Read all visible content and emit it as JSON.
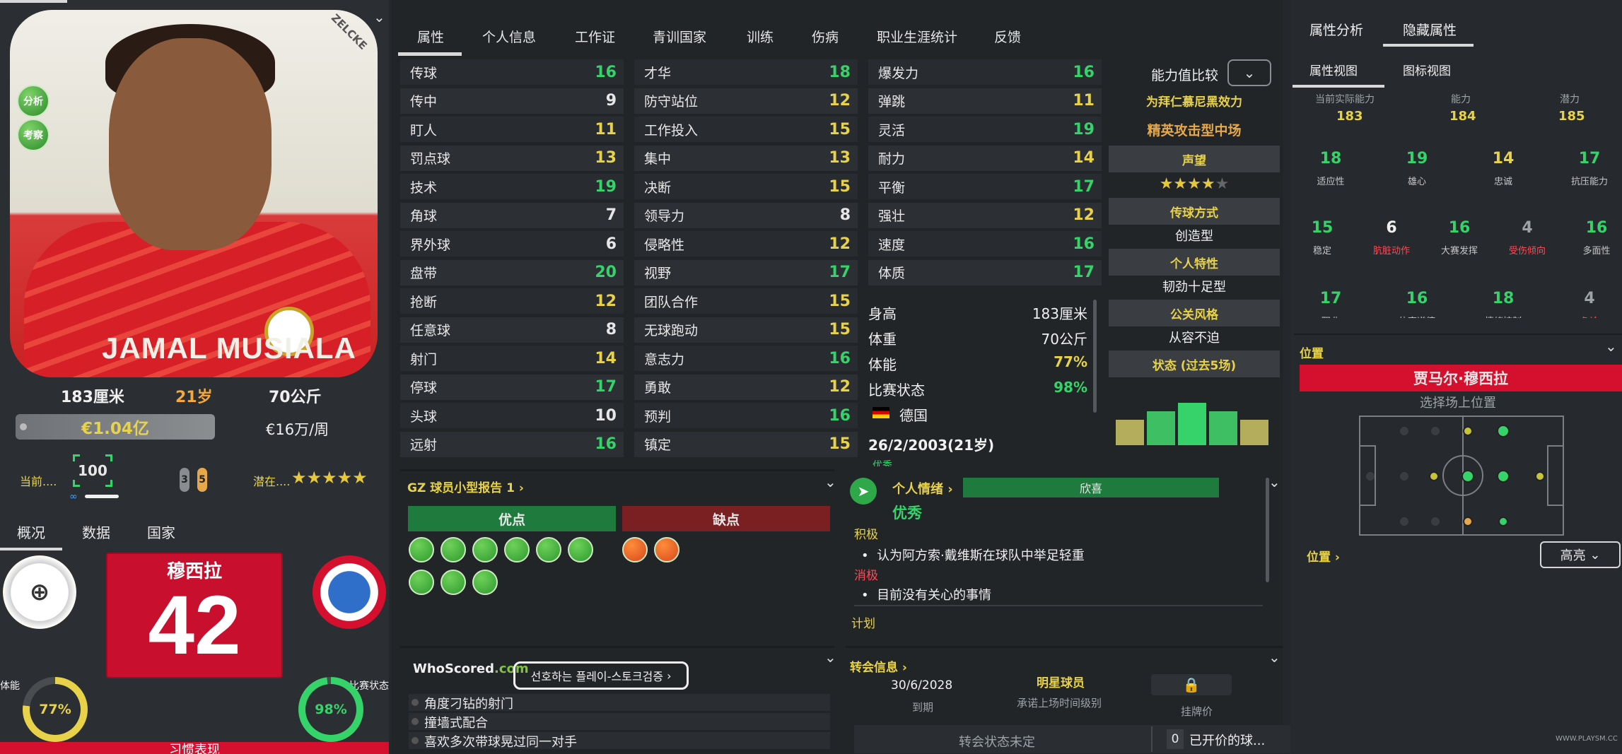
{
  "left": {
    "photo": {
      "brand": "ZELCKE",
      "shirt_name": "JAMAL MUSIALA",
      "btn_analyze": "分析",
      "btn_scout": "考察"
    },
    "height": "183厘米",
    "age": "21岁",
    "weight": "70公斤",
    "value": "€1.04亿",
    "wage": "€16万/周",
    "current_label": "当前....",
    "current_value": "100",
    "pill1": "3",
    "pill2": "5",
    "potential_label": "潜在....",
    "potential_stars": "★★★★★",
    "tabs": {
      "overview": "概况",
      "data": "数据",
      "nation": "国家"
    },
    "jersey_name": "穆西拉",
    "jersey_number": "42",
    "fitness_label": "体能",
    "fitness_value": "77%",
    "form_label": "比赛状态",
    "form_value": "98%",
    "fitness_pct": 77,
    "form_pct": 98,
    "bottom_text": "习惯表现"
  },
  "tabs": [
    "属性",
    "个人信息",
    "工作证",
    "青训国家",
    "训练",
    "伤病",
    "职业生涯统计",
    "反馈"
  ],
  "attributes": {
    "col1": [
      {
        "name": "传球",
        "value": "16"
      },
      {
        "name": "传中",
        "value": "9"
      },
      {
        "name": "盯人",
        "value": "11"
      },
      {
        "name": "罚点球",
        "value": "13"
      },
      {
        "name": "技术",
        "value": "19"
      },
      {
        "name": "角球",
        "value": "7"
      },
      {
        "name": "界外球",
        "value": "6"
      },
      {
        "name": "盘带",
        "value": "20"
      },
      {
        "name": "抢断",
        "value": "12"
      },
      {
        "name": "任意球",
        "value": "8"
      },
      {
        "name": "射门",
        "value": "14"
      },
      {
        "name": "停球",
        "value": "17"
      },
      {
        "name": "头球",
        "value": "10"
      },
      {
        "name": "远射",
        "value": "16"
      }
    ],
    "col2": [
      {
        "name": "才华",
        "value": "18"
      },
      {
        "name": "防守站位",
        "value": "12"
      },
      {
        "name": "工作投入",
        "value": "15"
      },
      {
        "name": "集中",
        "value": "13"
      },
      {
        "name": "决断",
        "value": "15"
      },
      {
        "name": "领导力",
        "value": "8"
      },
      {
        "name": "侵略性",
        "value": "12"
      },
      {
        "name": "视野",
        "value": "17"
      },
      {
        "name": "团队合作",
        "value": "15"
      },
      {
        "name": "无球跑动",
        "value": "15"
      },
      {
        "name": "意志力",
        "value": "16"
      },
      {
        "name": "勇敢",
        "value": "12"
      },
      {
        "name": "预判",
        "value": "16"
      },
      {
        "name": "镇定",
        "value": "15"
      }
    ],
    "col3": [
      {
        "name": "爆发力",
        "value": "16"
      },
      {
        "name": "弹跳",
        "value": "11"
      },
      {
        "name": "灵活",
        "value": "19"
      },
      {
        "name": "耐力",
        "value": "14"
      },
      {
        "name": "平衡",
        "value": "17"
      },
      {
        "name": "强壮",
        "value": "12"
      },
      {
        "name": "速度",
        "value": "16"
      },
      {
        "name": "体质",
        "value": "17"
      }
    ]
  },
  "info": {
    "height_label": "身高",
    "height": "183厘米",
    "weight_label": "体重",
    "weight": "70公斤",
    "fitness_label": "体能",
    "fitness": "77%",
    "form_label": "比赛状态",
    "form": "98%",
    "nation": "德国",
    "dob": "26/2/2003(21岁)",
    "cut_label": "优秀"
  },
  "side": {
    "compare": "能力值比较",
    "club": "为拜仁慕尼黑效力",
    "role": "精英攻击型中场",
    "rep_header": "声望",
    "rep_stars": "★★★★",
    "rep_empty": "★",
    "pass_header": "传球方式",
    "pass_value": "创造型",
    "trait_header": "个人特性",
    "trait_value": "韧劲十足型",
    "media_header": "公关风格",
    "media_value": "从容不迫",
    "form_header": "状态 (过去5场)",
    "form_bars": [
      3,
      4,
      5,
      4,
      3
    ]
  },
  "report": {
    "title": "GZ 球员小型报告 1",
    "pros": "优点",
    "cons": "缺点"
  },
  "mood": {
    "title": "个人情绪",
    "bar": "欣喜",
    "status": "优秀",
    "pos_label": "积极",
    "pos_item": "认为阿方索·戴维斯在球队中举足轻重",
    "neg_label": "消极",
    "neg_item": "目前没有关心的事情",
    "plan_label": "计划"
  },
  "whoscored": {
    "logo": "WhoScored",
    "logo_suffix": ".com",
    "button": "선호하는 플레이-스토크검증",
    "items": [
      "角度刁钻的射门",
      "撞墙式配合",
      "喜欢多次带球晃过同一对手"
    ]
  },
  "transfer": {
    "title": "转会信息",
    "date": "30/6/2028",
    "date_label": "到期",
    "star": "明星球员",
    "star_label": "承诺上场时间级别",
    "price_label": "挂牌价",
    "status": "转会状态未定",
    "offers_count": "0",
    "offers": "已开价的球..."
  },
  "right": {
    "tab1": "属性分析",
    "tab2": "隐藏属性",
    "sub1": "属性视图",
    "sub2": "图标视图",
    "cur_label": "当前实际能力",
    "cur": "183",
    "ability_label": "能力",
    "ability": "184",
    "pot_label": "潜力",
    "pot": "185",
    "hidden": [
      {
        "label": "适应性",
        "value": "18"
      },
      {
        "label": "雄心",
        "value": "19"
      },
      {
        "label": "忠诚",
        "value": "14"
      },
      {
        "label": "抗压能力",
        "value": "17"
      },
      {
        "label": "稳定",
        "value": "15"
      },
      {
        "label": "肮脏动作",
        "value": "6"
      },
      {
        "label": "大赛发挥",
        "value": "16"
      },
      {
        "label": "受伤倾向",
        "value": "4"
      },
      {
        "label": "多面性",
        "value": "16"
      },
      {
        "label": "职业",
        "value": "17"
      },
      {
        "label": "体育道德",
        "value": "16"
      },
      {
        "label": "情绪控制",
        "value": "18"
      },
      {
        "label": "争论",
        "value": "4"
      }
    ],
    "position_title": "位置",
    "player_name": "贾马尔·穆西拉",
    "choose_pos": "选择场上位置",
    "pos_link": "位置",
    "highlight": "高亮"
  },
  "watermark": "WWW.PLAYSM.CC"
}
